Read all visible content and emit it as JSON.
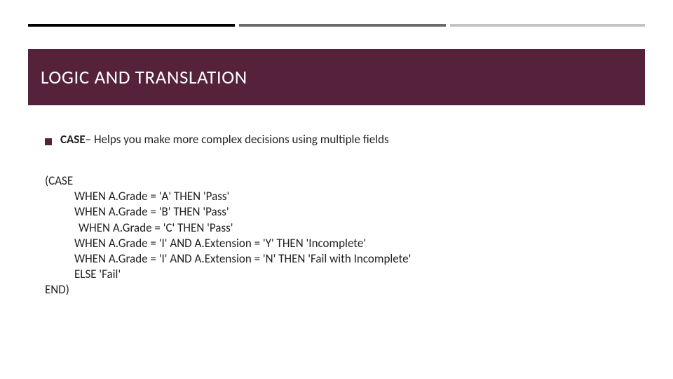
{
  "title": "LOGIC AND TRANSLATION",
  "bullet": {
    "keyword": "CASE",
    "desc": "– Helps you make more complex decisions using multiple fields"
  },
  "code": {
    "open": "(CASE",
    "when1": "WHEN A.Grade = 'A' THEN 'Pass'",
    "when2": "WHEN A.Grade = 'B' THEN 'Pass'",
    "when3": " WHEN A.Grade = 'C' THEN 'Pass'",
    "when4": "WHEN A.Grade = 'I' AND A.Extension = 'Y' THEN 'Incomplete'",
    "when5": "WHEN A.Grade = 'I' AND A.Extension = 'N' THEN 'Fail with Incomplete'",
    "else": "ELSE 'Fail'",
    "close": "END)"
  }
}
